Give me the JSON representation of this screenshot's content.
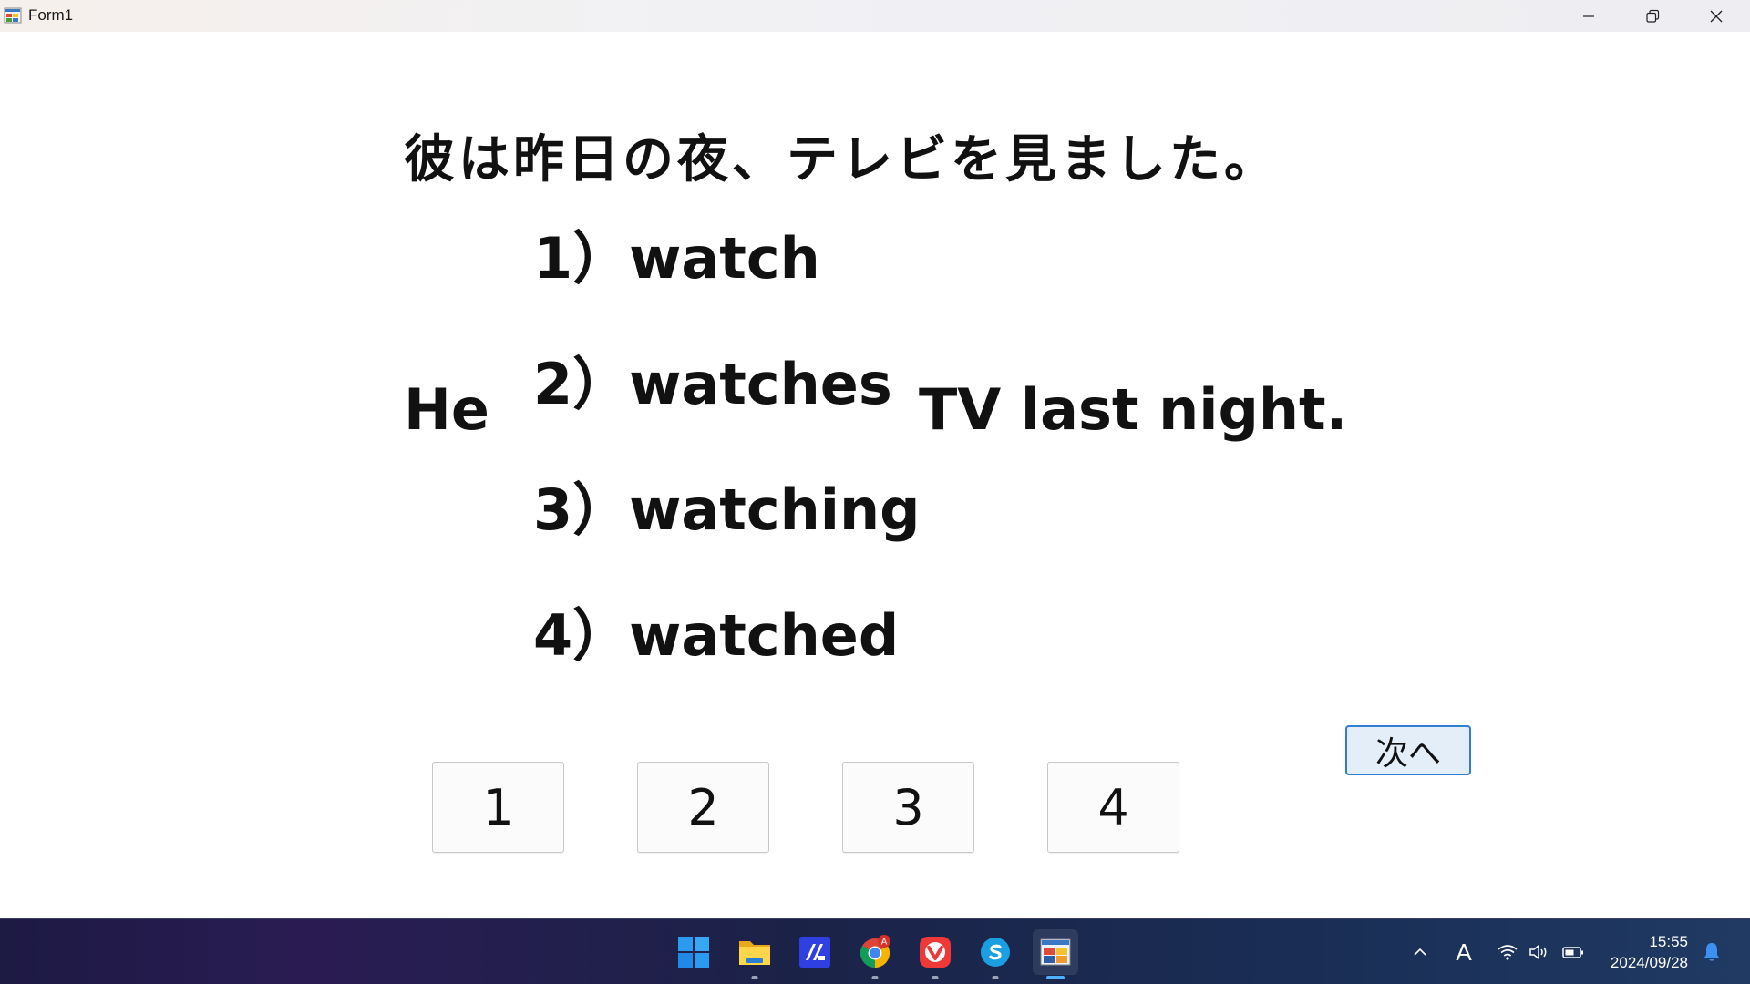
{
  "window": {
    "title": "Form1"
  },
  "question": {
    "japanese": "彼は昨日の夜、テレビを見ました。",
    "subject": "He",
    "rest": "TV last night.",
    "options": [
      {
        "number": "1）",
        "text": "watch"
      },
      {
        "number": "2）",
        "text": "watches"
      },
      {
        "number": "3）",
        "text": "watching"
      },
      {
        "number": "4）",
        "text": "watched"
      }
    ]
  },
  "answer_buttons": [
    "1",
    "2",
    "3",
    "4"
  ],
  "next_button": "次へ",
  "taskbar": {
    "apps": [
      "start",
      "file-explorer",
      "app-a",
      "chrome",
      "vivaldi",
      "skype",
      "form1-app"
    ],
    "chrome_badge": "A",
    "ime_indicator": "A",
    "time": "15:55",
    "date": "2024/09/28"
  },
  "colors": {
    "next_border": "#2f80d0",
    "next_bg": "#e3eef9",
    "running_indicator": "#4fb0ff"
  }
}
